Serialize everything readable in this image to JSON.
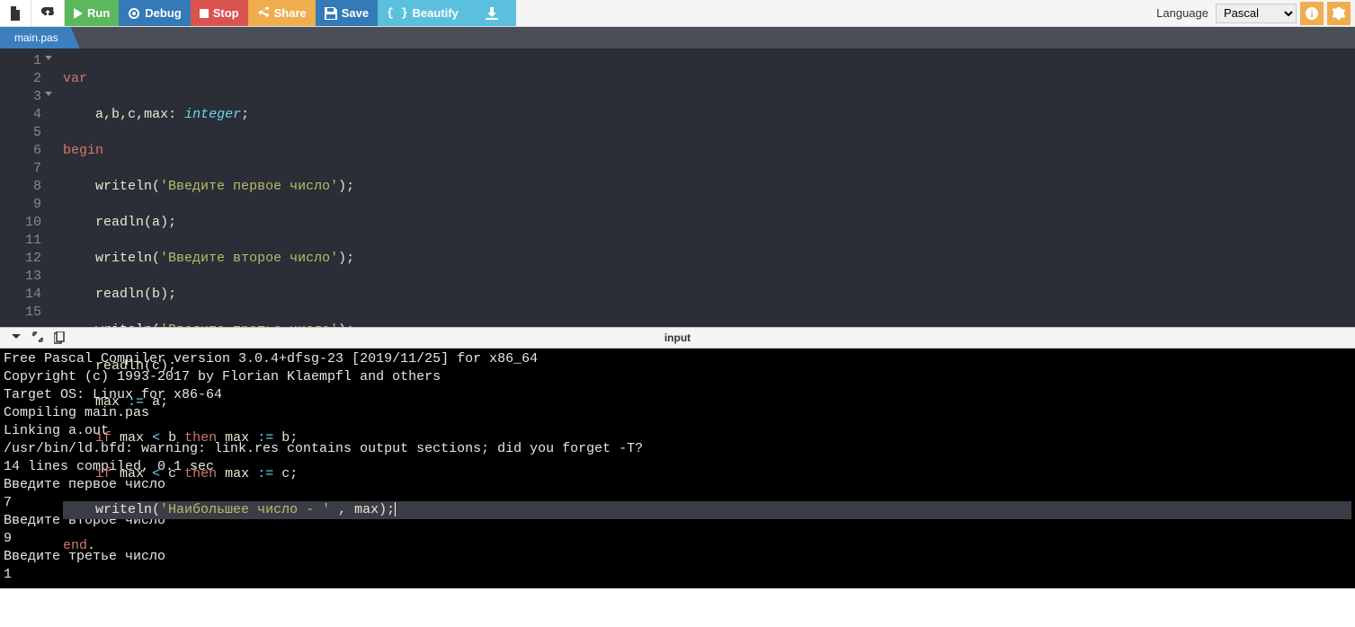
{
  "toolbar": {
    "run": "Run",
    "debug": "Debug",
    "stop": "Stop",
    "share": "Share",
    "save": "Save",
    "beautify": "Beautify"
  },
  "lang": {
    "label": "Language",
    "selected": "Pascal"
  },
  "tab": {
    "name": "main.pas"
  },
  "code": {
    "lines": [
      {
        "n": 1,
        "fold": true
      },
      {
        "n": 2
      },
      {
        "n": 3,
        "fold": true
      },
      {
        "n": 4
      },
      {
        "n": 5
      },
      {
        "n": 6
      },
      {
        "n": 7
      },
      {
        "n": 8
      },
      {
        "n": 9
      },
      {
        "n": 10
      },
      {
        "n": 11
      },
      {
        "n": 12
      },
      {
        "n": 13
      },
      {
        "n": 14
      },
      {
        "n": 15
      }
    ],
    "t": {
      "var": "var",
      "a": "a",
      "b": "b",
      "c": "c",
      "max": "max",
      "integer": "integer",
      "begin": "begin",
      "writeln": "writeln",
      "readln": "readln",
      "s1": "'Введите первое число'",
      "s2": "'Введите второе число'",
      "s3": "'Введите третье число'",
      "s4": "'Наибольшее число - '",
      "assign": ":=",
      "if": "if",
      "lt": "<",
      "then": "then",
      "end": "end"
    }
  },
  "splitter": {
    "label": "input"
  },
  "console": "Free Pascal Compiler version 3.0.4+dfsg-23 [2019/11/25] for x86_64\nCopyright (c) 1993-2017 by Florian Klaempfl and others\nTarget OS: Linux for x86-64\nCompiling main.pas\nLinking a.out\n/usr/bin/ld.bfd: warning: link.res contains output sections; did you forget -T?\n14 lines compiled, 0.1 sec\nВведите первое число\n7\nВведите второе число\n9\nВведите третье число\n1"
}
